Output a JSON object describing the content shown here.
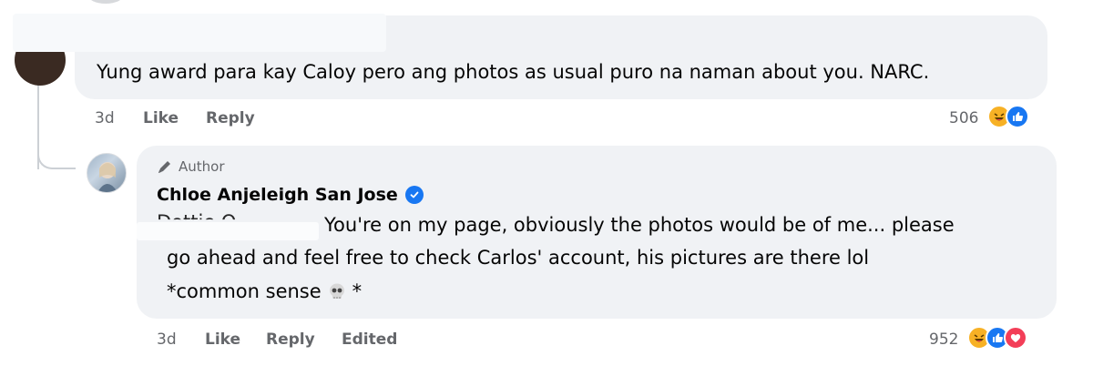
{
  "top_comment": {
    "text": "Yung award para kay Caloy pero ang photos as usual puro na naman about you. NARC.",
    "time": "3d",
    "like_label": "Like",
    "reply_label": "Reply",
    "reaction_count": "506",
    "reactions": [
      "haha",
      "like"
    ]
  },
  "reply": {
    "author_badge": "Author",
    "name": "Chloe Anjeleigh San Jose",
    "verified": true,
    "mention_partial": "Dottie O",
    "line1": "You're on my page, obviously the photos would be of me... please",
    "line2": "go ahead and feel free to check Carlos' account, his pictures are there lol",
    "line3_prefix": "*common sense",
    "line3_suffix": "*",
    "emoji": "skull",
    "time": "3d",
    "like_label": "Like",
    "reply_label": "Reply",
    "edited_label": "Edited",
    "reaction_count": "952",
    "reactions": [
      "haha",
      "like",
      "love"
    ]
  },
  "colors": {
    "bubble": "#f0f2f5",
    "meta_text": "#65676b",
    "verified": "#1877f2",
    "haha": "#f7b125",
    "like": "#1877f2",
    "love": "#f33e58"
  }
}
